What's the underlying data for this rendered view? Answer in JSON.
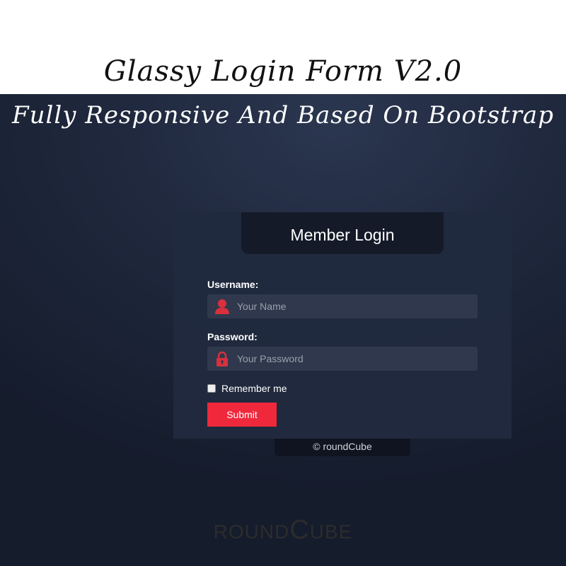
{
  "heading": {
    "line1": "Glassy Login Form V2.0",
    "line2": "Fully Responsive And Based On Bootstrap"
  },
  "form": {
    "title": "Member Login",
    "username_label": "Username:",
    "username_placeholder": "Your Name",
    "username_icon": "user-icon",
    "password_label": "Password:",
    "password_placeholder": "Your Password",
    "password_icon": "lock-icon",
    "remember_label": "Remember me",
    "remember_checked": false,
    "submit_label": "Submit"
  },
  "footer": {
    "copyright": "© roundCube",
    "brand_pre": "ROUND",
    "brand_big": "C",
    "brand_post": "UBE"
  },
  "colors": {
    "accent": "#f0283c",
    "icon": "#d8303c",
    "panel": "#212a3e",
    "background": "#1f283d"
  }
}
